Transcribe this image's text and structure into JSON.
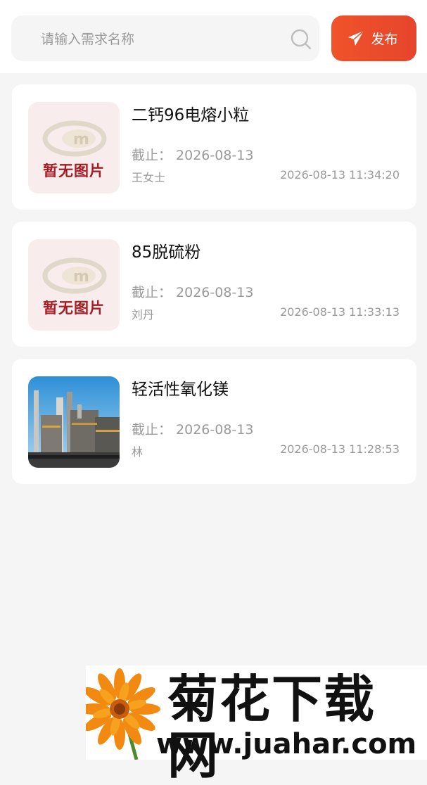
{
  "search": {
    "placeholder": "请输入需求名称",
    "value": ""
  },
  "publish": {
    "label": "发布"
  },
  "items": [
    {
      "title": "二钙96电熔小粒",
      "deadline": "截止：  2026-08-13",
      "contact": "王女士",
      "time": "2026-08-13 11:34:20",
      "image": "no-image",
      "image_text": "暂无图片"
    },
    {
      "title": "85脱硫粉",
      "deadline": "截止：  2026-08-13",
      "contact": "刘丹",
      "time": "2026-08-13 11:33:13",
      "image": "no-image",
      "image_text": "暂无图片"
    },
    {
      "title": "轻活性氧化镁",
      "deadline": "截止：  2026-08-13",
      "contact": "林",
      "time": "2026-08-13 11:28:53",
      "image": "factory-photo"
    }
  ],
  "watermark": {
    "title": "菊花下载网",
    "url": "www.juahar.com"
  },
  "colors": {
    "accent": "#ee4d2d",
    "background": "#f5f5f5",
    "card": "#ffffff",
    "muted_text": "#9a9a9a"
  }
}
